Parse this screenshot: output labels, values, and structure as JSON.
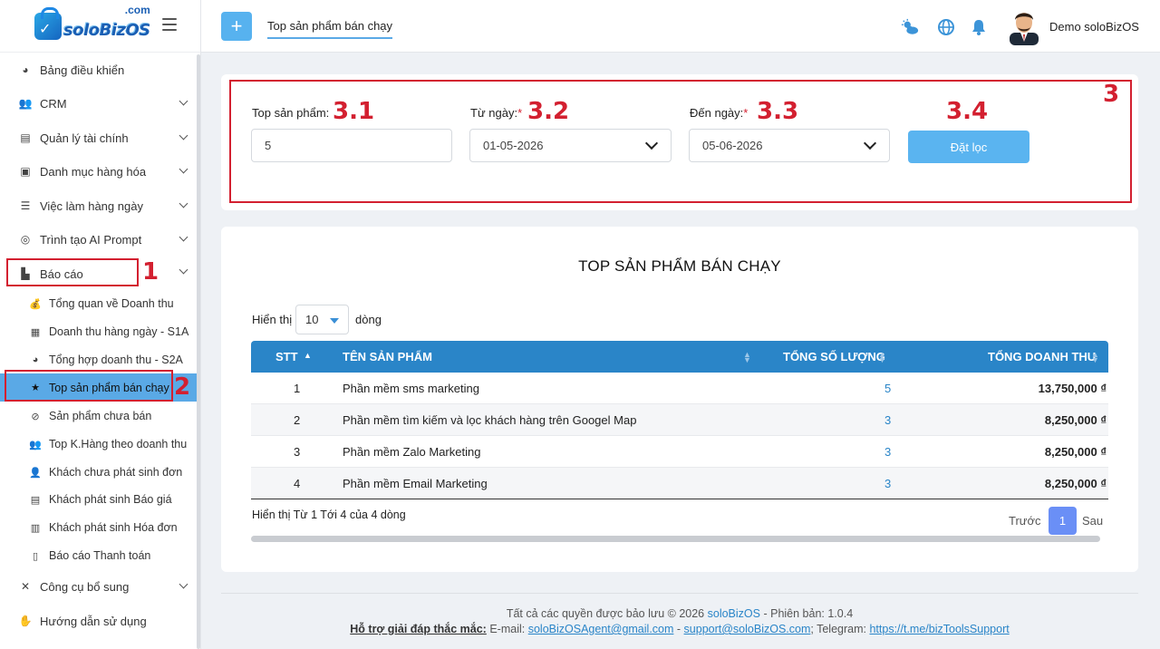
{
  "brand": {
    "name": "soloBizOS",
    "suffix": ".com"
  },
  "sidebar": {
    "items": [
      {
        "label": "Bảng điều khiển",
        "icon": "pie-chart-icon"
      },
      {
        "label": "CRM",
        "icon": "users-icon"
      },
      {
        "label": "Quản lý tài chính",
        "icon": "file-invoice-icon"
      },
      {
        "label": "Danh mục hàng hóa",
        "icon": "box-icon"
      },
      {
        "label": "Việc làm hàng ngày",
        "icon": "task-list-icon"
      },
      {
        "label": "Trình tạo AI Prompt",
        "icon": "brain-icon"
      },
      {
        "label": "Báo cáo",
        "icon": "bar-chart-icon"
      },
      {
        "label": "Công cụ bổ sung",
        "icon": "tools-icon"
      },
      {
        "label": "Hướng dẫn sử dụng",
        "icon": "hand-icon"
      }
    ],
    "report_sub": [
      {
        "label": "Tổng quan về Doanh thu",
        "icon": "money-bag-icon"
      },
      {
        "label": "Doanh thu hàng ngày - S1A",
        "icon": "calendar-icon"
      },
      {
        "label": "Tổng hợp doanh thu - S2A",
        "icon": "pie-chart-icon"
      },
      {
        "label": "Top sản phẩm bán chạy",
        "icon": "star-icon"
      },
      {
        "label": "Sản phẩm chưa bán",
        "icon": "ban-icon"
      },
      {
        "label": "Top K.Hàng theo doanh thu",
        "icon": "users-icon"
      },
      {
        "label": "Khách chưa phát sinh đơn",
        "icon": "user-clock-icon"
      },
      {
        "label": "Khách phát sinh Báo giá",
        "icon": "file-icon"
      },
      {
        "label": "Khách phát sinh Hóa đơn",
        "icon": "file-invoice-icon"
      },
      {
        "label": "Báo cáo Thanh toán",
        "icon": "receipt-icon"
      }
    ]
  },
  "annotations": {
    "a1": "1",
    "a2": "2",
    "a3": "3",
    "a31": "3.1",
    "a32": "3.2",
    "a33": "3.3",
    "a34": "3.4"
  },
  "topbar": {
    "tab_label": "Top sản phẩm bán chạy",
    "user_name": "Demo soloBizOS"
  },
  "filter": {
    "top_label": "Top sản phẩm:",
    "top_value": "5",
    "from_label": "Từ ngày:",
    "from_value": "01-05-2026",
    "to_label": "Đến ngày:",
    "to_value": "05-06-2026",
    "required_mark": "*",
    "button": "Đặt lọc"
  },
  "report": {
    "title": "TOP SẢN PHẨM BÁN CHẠY",
    "show_prefix": "Hiển thị",
    "show_value": "10",
    "show_suffix": "dòng",
    "columns": [
      "STT",
      "TÊN SẢN PHẨM",
      "TỔNG SỐ LƯỢNG",
      "TỔNG DOANH THU"
    ],
    "rows": [
      {
        "stt": "1",
        "name": "Phần mềm sms marketing",
        "qty": "5",
        "revenue": "13,750,000 ₫"
      },
      {
        "stt": "2",
        "name": "Phần mềm tìm kiếm và lọc khách hàng trên Googel Map",
        "qty": "3",
        "revenue": "8,250,000 ₫"
      },
      {
        "stt": "3",
        "name": "Phần mềm Zalo Marketing",
        "qty": "3",
        "revenue": "8,250,000 ₫"
      },
      {
        "stt": "4",
        "name": "Phần mềm Email Marketing",
        "qty": "3",
        "revenue": "8,250,000 ₫"
      }
    ],
    "info": "Hiển thị Từ 1 Tới 4 của 4 dòng",
    "prev": "Trước",
    "page": "1",
    "next": "Sau"
  },
  "footer": {
    "copyright_prefix": "Tất cả các quyền được bảo lưu © 2026",
    "brand_link": "soloBizOS",
    "version": "- Phiên bản: 1.0.4",
    "support_label": "Hỗ trợ giải đáp thắc mắc:",
    "email_label": "E-mail:",
    "email1": "soloBizOSAgent@gmail.com",
    "sep": "-",
    "email2": "support@soloBizOS.com",
    "telegram_label": "; Telegram:",
    "telegram": "https://t.me/bizToolsSupport"
  },
  "colors": {
    "accent": "#2a85c8",
    "active_menu": "#5aa9e6",
    "annotation": "#d32030",
    "button": "#5ab4f0"
  }
}
